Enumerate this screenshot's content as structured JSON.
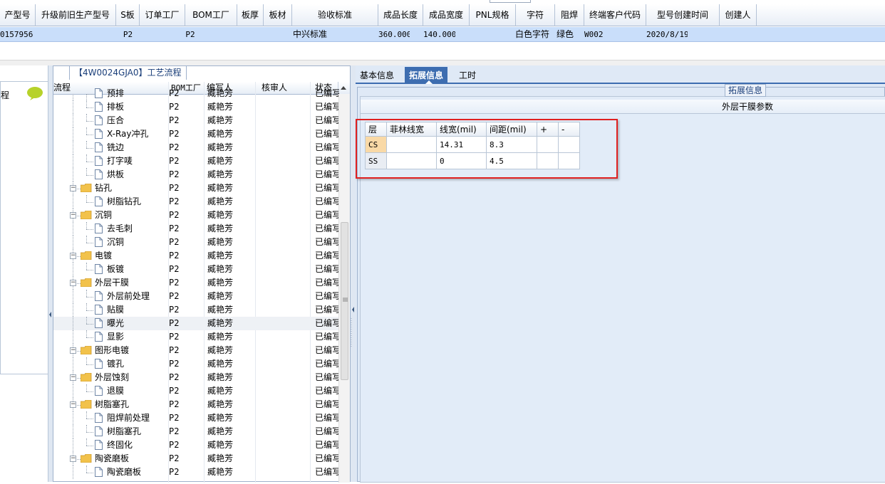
{
  "top_grid": {
    "columns": [
      {
        "label": "产型号"
      },
      {
        "label": "升级前旧生产型号"
      },
      {
        "label": "S板"
      },
      {
        "label": "订单工厂"
      },
      {
        "label": "BOM工厂"
      },
      {
        "label": "板厚"
      },
      {
        "label": "板材"
      },
      {
        "label": "验收标准"
      },
      {
        "label": "成品长度"
      },
      {
        "label": "成品宽度"
      },
      {
        "label": "PNL规格"
      },
      {
        "label": "字符"
      },
      {
        "label": "阻焊"
      },
      {
        "label": "终端客户代码"
      },
      {
        "label": "型号创建时间"
      },
      {
        "label": "创建人"
      }
    ],
    "row": {
      "model_no": "0157956",
      "old_model_no": "",
      "s_board": "P2",
      "order_factory": "P2",
      "bom_factory": "",
      "thickness": "",
      "material": "中兴标准",
      "acceptance": "",
      "length": "360.000",
      "width": "140.000",
      "pnl_spec": "",
      "character": "白色字符",
      "solder_mask": "绿色",
      "end_customer_code": "W002",
      "created_time": "2020/8/19",
      "creator": ""
    }
  },
  "left_panel": {
    "label": "程"
  },
  "flow_panel": {
    "title": "【4W0024GJA0】工艺流程",
    "columns": {
      "flow": "流程",
      "bom_factory": "BOM工厂",
      "writer": "编写人",
      "reviewer": "核审人",
      "status": "状态"
    },
    "rows": [
      {
        "name": "预排",
        "level": 2,
        "bom": "P2",
        "writer": "臧艳芳",
        "status": "已编写",
        "partial": true
      },
      {
        "name": "排板",
        "level": 2,
        "bom": "P2",
        "writer": "臧艳芳",
        "status": "已编写"
      },
      {
        "name": "压合",
        "level": 2,
        "bom": "P2",
        "writer": "臧艳芳",
        "status": "已编写"
      },
      {
        "name": "X-Ray冲孔",
        "level": 2,
        "bom": "P2",
        "writer": "臧艳芳",
        "status": "已编写"
      },
      {
        "name": "铣边",
        "level": 2,
        "bom": "P2",
        "writer": "臧艳芳",
        "status": "已编写"
      },
      {
        "name": "打字唛",
        "level": 2,
        "bom": "P2",
        "writer": "臧艳芳",
        "status": "已编写"
      },
      {
        "name": "烘板",
        "level": 2,
        "bom": "P2",
        "writer": "臧艳芳",
        "status": "已编写"
      },
      {
        "name": "钻孔",
        "level": 1,
        "bom": "P2",
        "writer": "臧艳芳",
        "status": "已编写"
      },
      {
        "name": "树脂钻孔",
        "level": 2,
        "bom": "P2",
        "writer": "臧艳芳",
        "status": "已编写"
      },
      {
        "name": "沉铜",
        "level": 1,
        "bom": "P2",
        "writer": "臧艳芳",
        "status": "已编写"
      },
      {
        "name": "去毛刺",
        "level": 2,
        "bom": "P2",
        "writer": "臧艳芳",
        "status": "已编写"
      },
      {
        "name": "沉铜",
        "level": 2,
        "bom": "P2",
        "writer": "臧艳芳",
        "status": "已编写"
      },
      {
        "name": "电镀",
        "level": 1,
        "bom": "P2",
        "writer": "臧艳芳",
        "status": "已编写"
      },
      {
        "name": "板镀",
        "level": 2,
        "bom": "P2",
        "writer": "臧艳芳",
        "status": "已编写"
      },
      {
        "name": "外层干膜",
        "level": 1,
        "bom": "P2",
        "writer": "臧艳芳",
        "status": "已编写"
      },
      {
        "name": "外层前处理",
        "level": 2,
        "bom": "P2",
        "writer": "臧艳芳",
        "status": "已编写"
      },
      {
        "name": "贴膜",
        "level": 2,
        "bom": "P2",
        "writer": "臧艳芳",
        "status": "已编写"
      },
      {
        "name": "曝光",
        "level": 2,
        "bom": "P2",
        "writer": "臧艳芳",
        "status": "已编写",
        "selected": true
      },
      {
        "name": "显影",
        "level": 2,
        "bom": "P2",
        "writer": "臧艳芳",
        "status": "已编写"
      },
      {
        "name": "图形电镀",
        "level": 1,
        "bom": "P2",
        "writer": "臧艳芳",
        "status": "已编写"
      },
      {
        "name": "镀孔",
        "level": 2,
        "bom": "P2",
        "writer": "臧艳芳",
        "status": "已编写"
      },
      {
        "name": "外层蚀刻",
        "level": 1,
        "bom": "P2",
        "writer": "臧艳芳",
        "status": "已编写"
      },
      {
        "name": "退膜",
        "level": 2,
        "bom": "P2",
        "writer": "臧艳芳",
        "status": "已编写"
      },
      {
        "name": "树脂塞孔",
        "level": 1,
        "bom": "P2",
        "writer": "臧艳芳",
        "status": "已编写"
      },
      {
        "name": "阻焊前处理",
        "level": 2,
        "bom": "P2",
        "writer": "臧艳芳",
        "status": "已编写"
      },
      {
        "name": "树脂塞孔",
        "level": 2,
        "bom": "P2",
        "writer": "臧艳芳",
        "status": "已编写"
      },
      {
        "name": "终固化",
        "level": 2,
        "bom": "P2",
        "writer": "臧艳芳",
        "status": "已编写"
      },
      {
        "name": "陶瓷磨板",
        "level": 1,
        "bom": "P2",
        "writer": "臧艳芳",
        "status": "已编写"
      },
      {
        "name": "陶瓷磨板",
        "level": 2,
        "bom": "P2",
        "writer": "臧艳芳",
        "status": "已编写"
      }
    ]
  },
  "right_panel": {
    "tabs": [
      {
        "label": "基本信息",
        "active": false
      },
      {
        "label": "拓展信息",
        "active": true
      },
      {
        "label": "工时",
        "active": false
      }
    ],
    "ext_title": "拓展信息",
    "group_header": "外层干膜参数",
    "param_table": {
      "headers": [
        "层",
        "菲林线宽",
        "线宽(mil)",
        "间距(mil)",
        "+",
        "-"
      ],
      "rows": [
        {
          "layer": "CS",
          "film_width": "",
          "line_width": "14.31",
          "spacing": "8.3",
          "selected": true
        },
        {
          "layer": "SS",
          "film_width": "",
          "line_width": "0",
          "spacing": "4.5",
          "selected": false
        }
      ]
    }
  },
  "colors": {
    "selected_row": "#c9defa",
    "tab_active": "#3d6db0",
    "highlight_box": "#e02020",
    "layer_header": "#f7c679",
    "folder": "#f2c24b"
  }
}
